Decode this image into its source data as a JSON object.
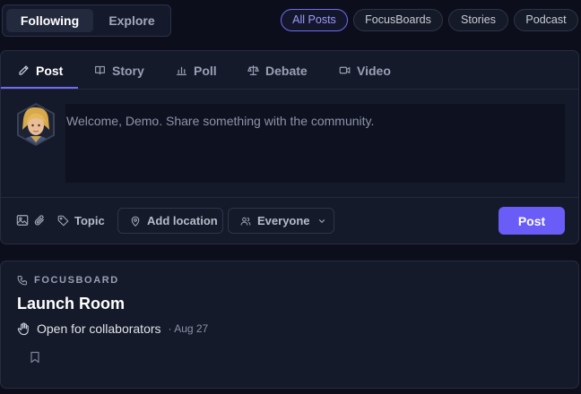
{
  "feed_toggle": {
    "following": "Following",
    "explore": "Explore"
  },
  "filters": [
    "All Posts",
    "FocusBoards",
    "Stories",
    "Podcast"
  ],
  "composer": {
    "tabs": [
      {
        "label": "Post",
        "icon": "pen-icon"
      },
      {
        "label": "Story",
        "icon": "book-icon"
      },
      {
        "label": "Poll",
        "icon": "bar-chart-icon"
      },
      {
        "label": "Debate",
        "icon": "scales-icon"
      },
      {
        "label": "Video",
        "icon": "video-icon"
      }
    ],
    "placeholder": "Welcome, Demo. Share something with the community.",
    "topic_label": "Topic",
    "location_label": "Add location",
    "audience_label": "Everyone",
    "post_label": "Post"
  },
  "feed_item": {
    "type_label": "FOCUSBOARD",
    "title": "Launch Room",
    "status": "Open for collaborators",
    "date": "· Aug 27"
  },
  "colors": {
    "accent": "#6f6cf2",
    "post_button": "#6a5cf6",
    "background": "#0c0f1b",
    "card": "#151a2a"
  }
}
